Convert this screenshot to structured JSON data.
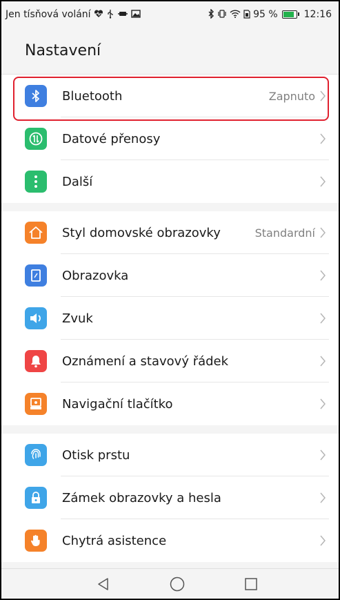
{
  "status_bar": {
    "carrier": "Jen tísňová volání",
    "battery_percent": "95 %",
    "time": "12:16",
    "icons": [
      "heart-monitor-icon",
      "usb-icon",
      "usb-debug-icon",
      "gallery-icon",
      "bluetooth-icon",
      "vibrate-icon",
      "wifi-icon",
      "sim-icon",
      "battery-icon"
    ]
  },
  "header": {
    "title": "Nastavení"
  },
  "groups": [
    {
      "items": [
        {
          "label": "Bluetooth",
          "value": "Zapnuto",
          "icon": "bluetooth-icon",
          "color": "#3f7fe0"
        },
        {
          "label": "Datové přenosy",
          "value": "",
          "icon": "data-transfer-icon",
          "color": "#2bbd6e"
        },
        {
          "label": "Další",
          "value": "",
          "icon": "more-icon",
          "color": "#2bbd6e"
        }
      ]
    },
    {
      "items": [
        {
          "label": "Styl domovské obrazovky",
          "value": "Standardní",
          "icon": "home-icon",
          "color": "#f5822a"
        },
        {
          "label": "Obrazovka",
          "value": "",
          "icon": "display-icon",
          "color": "#3f7fe0"
        },
        {
          "label": "Zvuk",
          "value": "",
          "icon": "speaker-icon",
          "color": "#3fa5e8"
        },
        {
          "label": "Oznámení a stavový řádek",
          "value": "",
          "icon": "bell-icon",
          "color": "#ef4545"
        },
        {
          "label": "Navigační tlačítko",
          "value": "",
          "icon": "navigation-key-icon",
          "color": "#f5822a"
        }
      ]
    },
    {
      "items": [
        {
          "label": "Otisk prstu",
          "value": "",
          "icon": "fingerprint-icon",
          "color": "#3fa5e8"
        },
        {
          "label": "Zámek obrazovky a hesla",
          "value": "",
          "icon": "lock-icon",
          "color": "#3fa5e8"
        },
        {
          "label": "Chytrá asistence",
          "value": "",
          "icon": "hand-icon",
          "color": "#f5822a"
        }
      ]
    }
  ],
  "highlight": {
    "color": "#e0202e",
    "target": "Bluetooth"
  },
  "nav_bar": {
    "icons": [
      "back-icon",
      "home-circle-icon",
      "recents-icon"
    ]
  }
}
